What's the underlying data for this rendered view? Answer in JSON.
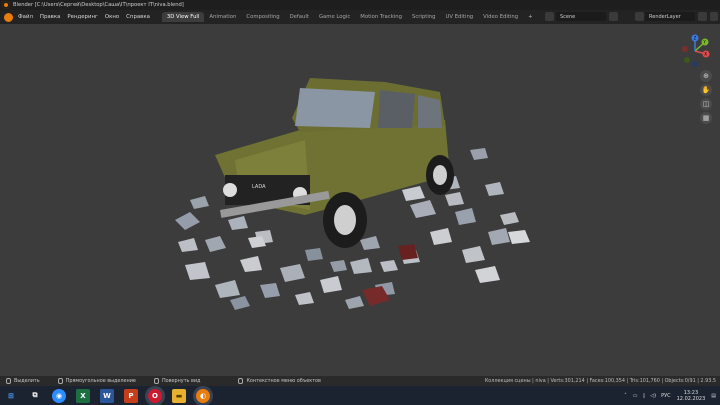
{
  "window": {
    "title": "Blender [C:\\Users\\Сергей\\Desktop\\Саша\\IT\\проект IT\\niva.blend]"
  },
  "menu": [
    "Файл",
    "Правка",
    "Рендеринг",
    "Окно",
    "Справка"
  ],
  "workspaces": {
    "active": "3D View Full",
    "tabs": [
      "3D View Full",
      "Animation",
      "Compositing",
      "Default",
      "Game Logic",
      "Motion Tracking",
      "Scripting",
      "UV Editing",
      "Video Editing"
    ],
    "add": "+"
  },
  "scene": {
    "label": "Scene"
  },
  "view_layer": {
    "label": "RenderLayer"
  },
  "gizmo": {
    "x": "X",
    "y": "Y",
    "z": "Z"
  },
  "car": {
    "badge": "LADA"
  },
  "statusbar": {
    "hint1": "Выделить",
    "hint2": "Прямоугольное выделение",
    "hint3": "Повернуть вид",
    "hint4": "Контекстное меню объектов",
    "stats": "Коллекция сцены | niva | Verts:301,214 | Faces:100,354 | Tris:101,760 | Objects:0/91 | 2.93.5"
  },
  "taskbar": {
    "apps": [
      {
        "name": "windows-start",
        "glyph": "⊞",
        "color": "#1b2330"
      },
      {
        "name": "task-view",
        "glyph": "⧉",
        "color": "#1b2330"
      },
      {
        "name": "zoom",
        "glyph": "◉",
        "color": "#2d8cff"
      },
      {
        "name": "excel",
        "glyph": "X",
        "color": "#1d6f42"
      },
      {
        "name": "word",
        "glyph": "W",
        "color": "#2b579a"
      },
      {
        "name": "powerpoint",
        "glyph": "P",
        "color": "#c43e1c"
      },
      {
        "name": "opera",
        "glyph": "O",
        "color": "#cc1b30"
      },
      {
        "name": "file-explorer",
        "glyph": "▬",
        "color": "#e8b030"
      },
      {
        "name": "blender",
        "glyph": "◐",
        "color": "#e87d0d"
      }
    ],
    "lang": "РУС",
    "time": "13:23",
    "date": "12.02.2023"
  }
}
